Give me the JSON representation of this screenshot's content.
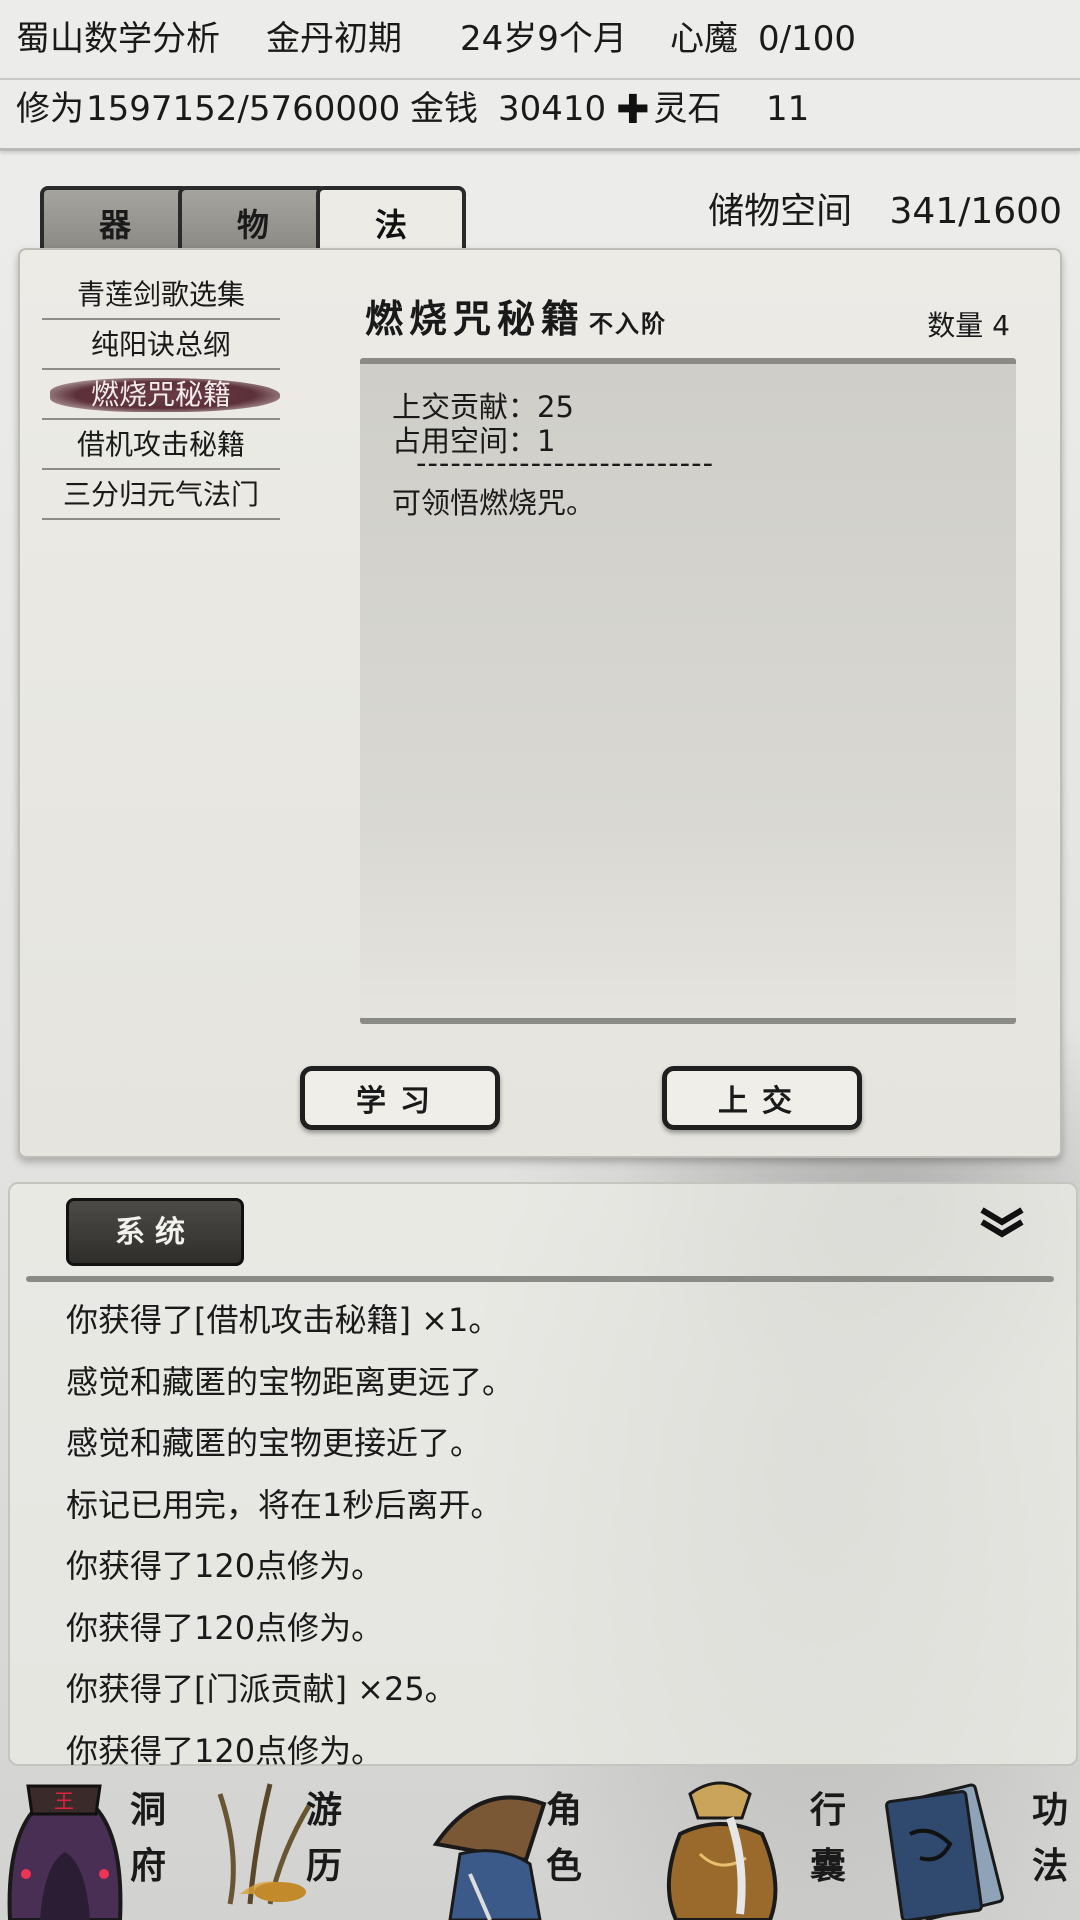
{
  "status": {
    "sect": "蜀山",
    "name": "数学分析",
    "realm": "金丹初期",
    "age": "24岁9个月",
    "heart_demon_label": "心魔",
    "heart_demon_value": "0/100",
    "cultivation_label": "修为",
    "cultivation_value": "1597152/5760000",
    "money_label": "金钱",
    "money_value": "30410",
    "spirit_stone_label": "灵石",
    "spirit_stone_value": "11"
  },
  "tabs": [
    {
      "label": "器",
      "active": false
    },
    {
      "label": "物",
      "active": false
    },
    {
      "label": "法",
      "active": true
    }
  ],
  "storage": {
    "label": "储物空间",
    "value": "341/1600"
  },
  "items": [
    {
      "name": "青莲剑歌选集",
      "selected": false
    },
    {
      "name": "纯阳诀总纲",
      "selected": false
    },
    {
      "name": "燃烧咒秘籍",
      "selected": true
    },
    {
      "name": "借机攻击秘籍",
      "selected": false
    },
    {
      "name": "三分归元气法门",
      "selected": false
    }
  ],
  "detail": {
    "title": "燃烧咒秘籍",
    "grade": "不入阶",
    "quantity": "数量 4",
    "contribution": "上交贡献：25",
    "space": "占用空间：1",
    "divider": "--------------------------",
    "description": "可领悟燃烧咒。",
    "learn_label": "学习",
    "submit_label": "上交"
  },
  "log": {
    "tab_label": "系统",
    "collapse_icon": "double-chevron-down-icon",
    "lines": [
      "你获得了[借机攻击秘籍] ×1。",
      "感觉和藏匿的宝物距离更远了。",
      "感觉和藏匿的宝物更接近了。",
      "标记已用完，将在1秒后离开。",
      "你获得了120点修为。",
      "你获得了120点修为。",
      "你获得了[门派贡献] ×25。",
      "你获得了120点修为。"
    ]
  },
  "nav": [
    {
      "label1": "洞",
      "label2": "府",
      "icon": "cave-dwelling-icon"
    },
    {
      "label1": "游",
      "label2": "历",
      "icon": "travel-grass-icon"
    },
    {
      "label1": "角",
      "label2": "色",
      "icon": "straw-hat-character-icon"
    },
    {
      "label1": "行",
      "label2": "囊",
      "icon": "bag-icon"
    },
    {
      "label1": "功",
      "label2": "法",
      "icon": "scripture-books-icon"
    }
  ],
  "colors": {
    "accent_selected": "#5c3039",
    "panel": "#ecebe6",
    "ink": "#1a1a1a"
  }
}
